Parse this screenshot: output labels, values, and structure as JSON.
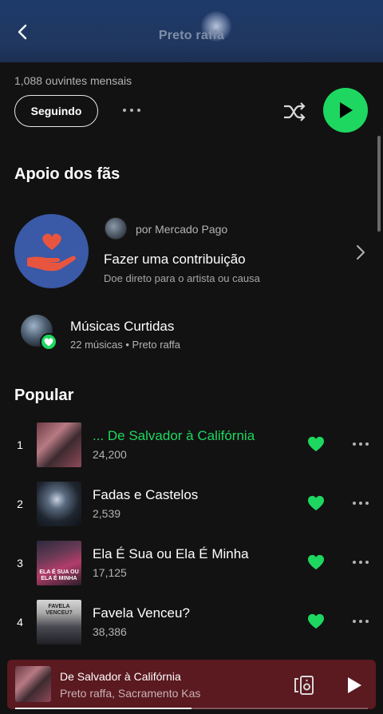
{
  "header": {
    "title": "Preto raffa"
  },
  "artist": {
    "monthly_listeners": "1,088 ouvintes mensais",
    "follow_label": "Seguindo"
  },
  "fan_support": {
    "section_title": "Apoio dos fãs",
    "by": "por Mercado Pago",
    "title": "Fazer uma contribuição",
    "subtitle": "Doe direto para o artista ou causa"
  },
  "liked_songs": {
    "title": "Músicas Curtidas",
    "subtitle": "22 músicas • Preto raffa"
  },
  "popular": {
    "section_title": "Popular",
    "tracks": [
      {
        "num": "1",
        "title": "... De Salvador à Califórnia",
        "plays": "24,200",
        "playing": true,
        "liked": true,
        "cover_text": ""
      },
      {
        "num": "2",
        "title": "Fadas e Castelos",
        "plays": "2,539",
        "playing": false,
        "liked": true,
        "cover_text": ""
      },
      {
        "num": "3",
        "title": "Ela É Sua ou Ela É Minha",
        "plays": "17,125",
        "playing": false,
        "liked": true,
        "cover_text": "ELA É SUA OU ELA É MINHA"
      },
      {
        "num": "4",
        "title": "Favela Venceu?",
        "plays": "38,386",
        "playing": false,
        "liked": true,
        "cover_text": "FAVELA VENCEU?"
      }
    ]
  },
  "now_playing": {
    "title": "De Salvador à Califórnia",
    "artists": "Preto raffa, Sacramento Kas",
    "progress": 0.5
  },
  "colors": {
    "accent": "#1ed760",
    "background": "#121212",
    "header": "#20375f",
    "mini_player": "#5b1920",
    "fan_circle": "#3a59a7"
  },
  "icons": {
    "back": "chevron-left-icon",
    "more": "more-horizontal-icon",
    "shuffle": "shuffle-icon",
    "play": "play-icon",
    "heart": "heart-icon",
    "chevron": "chevron-right-icon",
    "device": "speaker-device-icon"
  }
}
